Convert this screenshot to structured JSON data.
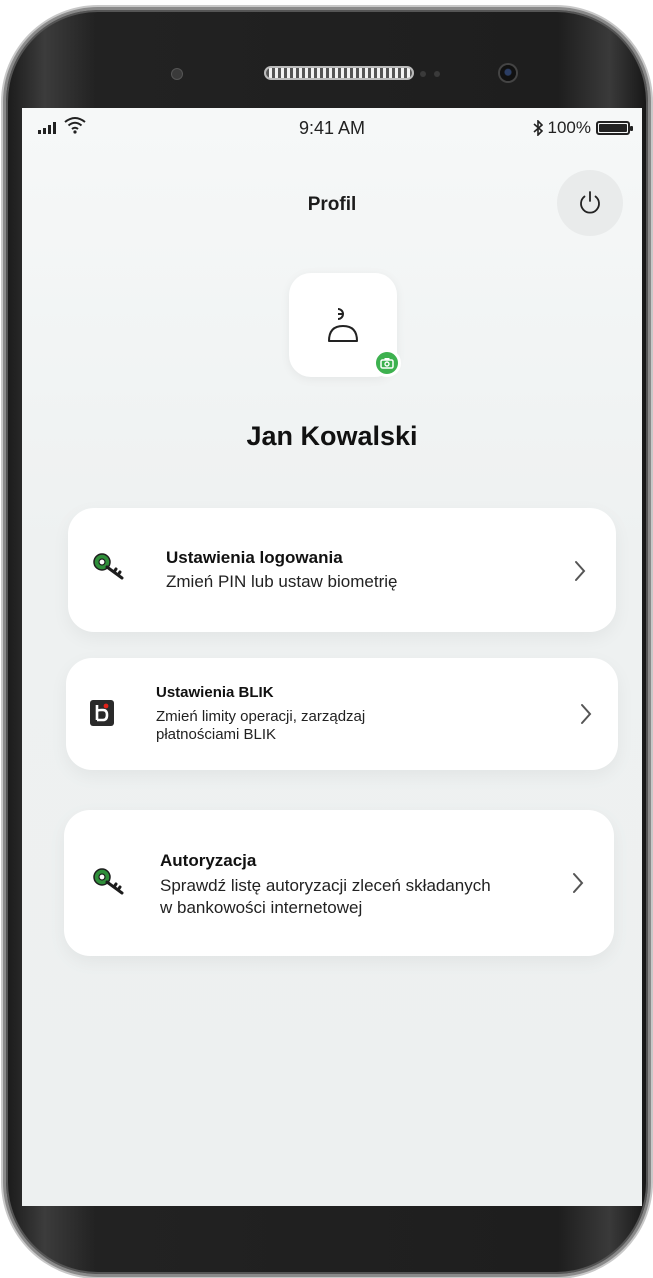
{
  "status_bar": {
    "time": "9:41 AM",
    "battery": "100%"
  },
  "header": {
    "title": "Profil",
    "power_icon": "power-icon"
  },
  "profile": {
    "avatar_icon": "user-icon",
    "camera_icon": "camera-icon",
    "name": "Jan Kowalski"
  },
  "menu": [
    {
      "icon": "key-icon",
      "title": "Ustawienia logowania",
      "subtitle": "Zmień PIN lub ustaw biometrię",
      "subtitle2": ""
    },
    {
      "icon": "blik-icon",
      "title": "Ustawienia BLIK",
      "subtitle": "Zmień limity operacji, zarządzaj",
      "subtitle2": "płatnościami BLIK"
    },
    {
      "icon": "key-icon",
      "title": "Autoryzacja",
      "subtitle": "Sprawdź listę autoryzacji zleceń składanych",
      "subtitle2": "w bankowości internetowej"
    }
  ],
  "colors": {
    "accent_green": "#3db14f",
    "key_green": "#2f8f3a",
    "blik_bg": "#2a2a2a",
    "blik_dot": "#e2231a"
  }
}
